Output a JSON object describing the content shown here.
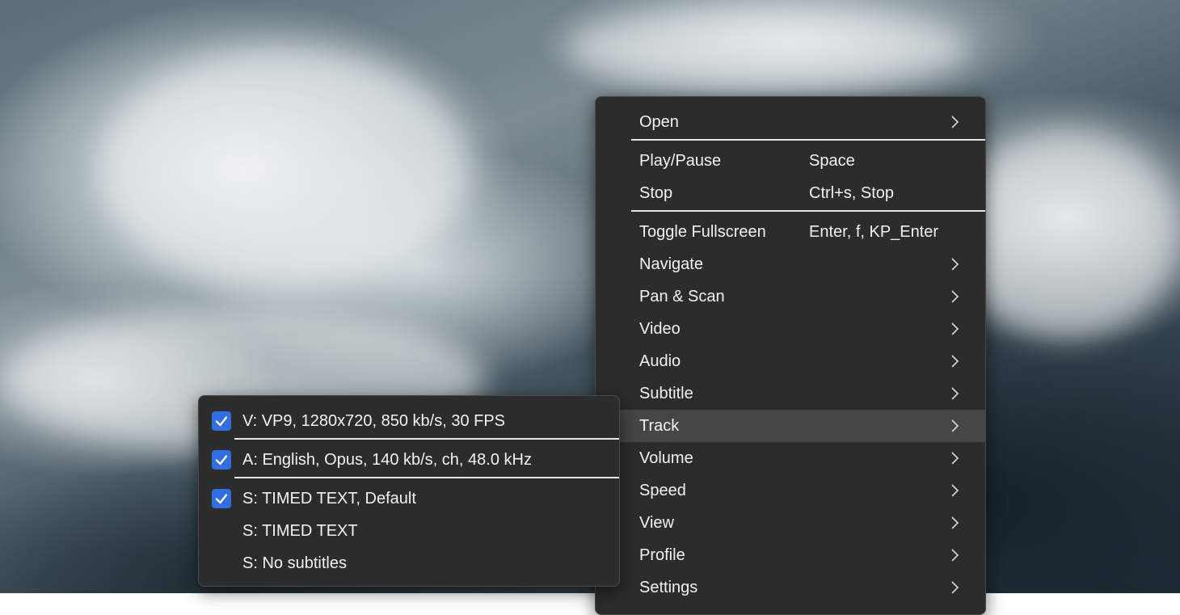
{
  "main_menu": {
    "items": [
      {
        "label": "Open",
        "shortcut": "",
        "submenu": true
      },
      {
        "label": "Play/Pause",
        "shortcut": "Space",
        "submenu": false
      },
      {
        "label": "Stop",
        "shortcut": "Ctrl+s, Stop",
        "submenu": false
      },
      {
        "label": "Toggle Fullscreen",
        "shortcut": "Enter, f, KP_Enter",
        "submenu": false
      },
      {
        "label": "Navigate",
        "shortcut": "",
        "submenu": true
      },
      {
        "label": "Pan & Scan",
        "shortcut": "",
        "submenu": true
      },
      {
        "label": "Video",
        "shortcut": "",
        "submenu": true
      },
      {
        "label": "Audio",
        "shortcut": "",
        "submenu": true
      },
      {
        "label": "Subtitle",
        "shortcut": "",
        "submenu": true
      },
      {
        "label": "Track",
        "shortcut": "",
        "submenu": true,
        "highlighted": true
      },
      {
        "label": "Volume",
        "shortcut": "",
        "submenu": true
      },
      {
        "label": "Speed",
        "shortcut": "",
        "submenu": true
      },
      {
        "label": "View",
        "shortcut": "",
        "submenu": true
      },
      {
        "label": "Profile",
        "shortcut": "",
        "submenu": true
      },
      {
        "label": "Settings",
        "shortcut": "",
        "submenu": true
      }
    ]
  },
  "track_menu": {
    "items": [
      {
        "label": "V: VP9, 1280x720, 850 kb/s, 30 FPS",
        "checked": true
      },
      {
        "label": "A: English, Opus, 140 kb/s, ch, 48.0 kHz",
        "checked": true
      },
      {
        "label": "S: TIMED TEXT, Default",
        "checked": true
      },
      {
        "label": "S: TIMED TEXT",
        "checked": false
      },
      {
        "label": "S: No subtitles",
        "checked": false
      }
    ]
  },
  "colors": {
    "menu_bg": "#2c2c2c",
    "highlight": "#464646",
    "check_accent": "#2f6fe0",
    "separator": "#e8e8e8"
  },
  "icons": {
    "submenu": "chevron-right-icon",
    "check": "checkmark-icon"
  }
}
